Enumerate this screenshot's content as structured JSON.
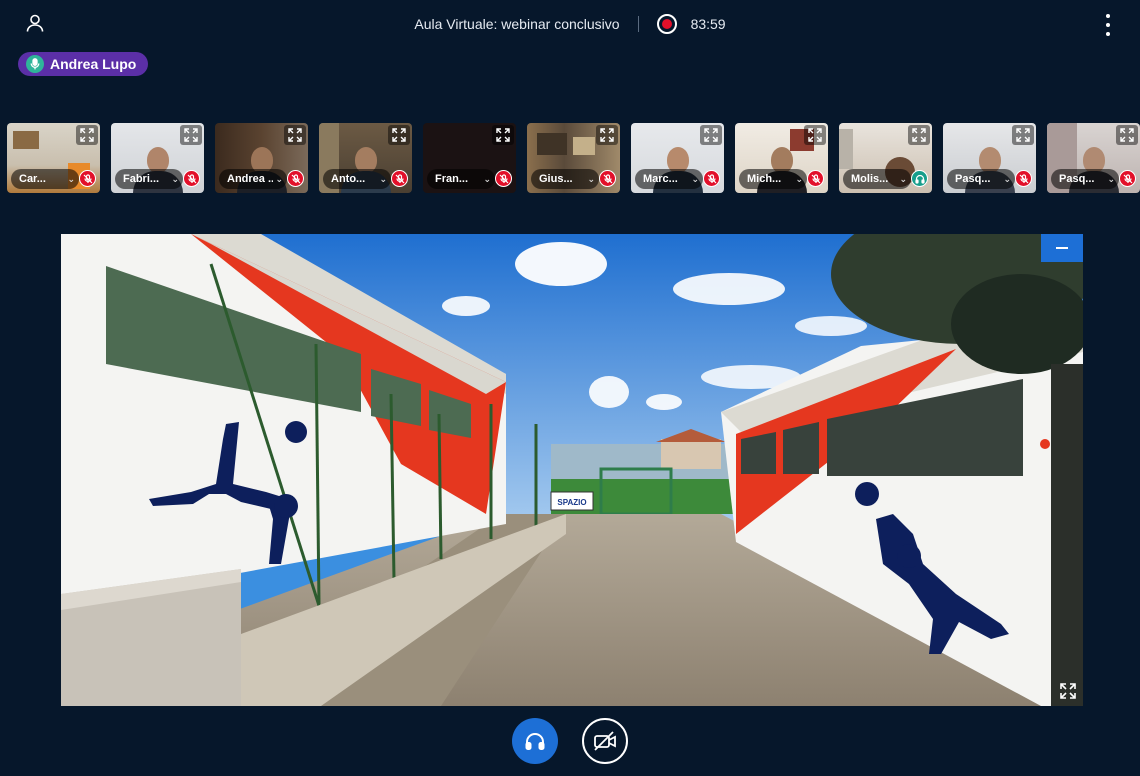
{
  "header": {
    "title": "Aula Virtuale: webinar conclusivo",
    "timer": "83:59"
  },
  "speaker": {
    "name": "Andrea Lupo"
  },
  "participants": [
    {
      "name": "Car...",
      "status": "muted"
    },
    {
      "name": "Fabri...",
      "status": "muted"
    },
    {
      "name": "Andrea ...",
      "status": "muted"
    },
    {
      "name": "Anto...",
      "status": "muted"
    },
    {
      "name": "Fran...",
      "status": "muted"
    },
    {
      "name": "Gius...",
      "status": "muted"
    },
    {
      "name": "Marc...",
      "status": "muted"
    },
    {
      "name": "Mich...",
      "status": "muted"
    },
    {
      "name": "Molis...",
      "status": "listen-only"
    },
    {
      "name": "Pasq...",
      "status": "muted"
    },
    {
      "name": "Pasq...",
      "status": "muted"
    }
  ],
  "presentation": {
    "signboard": "SPAZIO"
  },
  "colors": {
    "background": "#06172b",
    "accent": "#1d6fd6",
    "recording": "#e2102a",
    "speaker_pill": "#5b2fa7",
    "mic_talking": "#2fb59a",
    "listen_only": "#169e8b"
  },
  "icons": {
    "user": "user-icon",
    "record": "record-icon",
    "menu": "more-vertical-icon",
    "speaker_mic": "microphone-icon",
    "expand": "fullscreen-icon",
    "muted": "mic-off-icon",
    "listen_only": "headphones-icon",
    "audio_button": "headphones-icon",
    "video_button": "camera-off-icon",
    "minimize": "minimize-icon"
  }
}
